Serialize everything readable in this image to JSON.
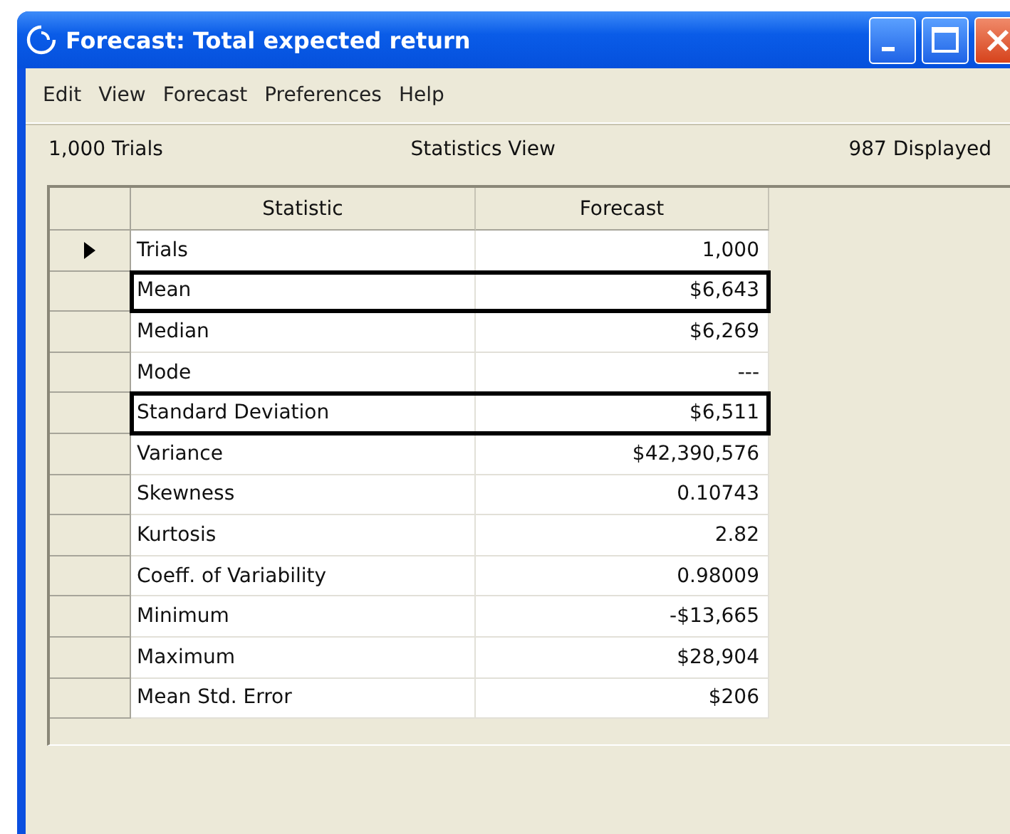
{
  "window": {
    "title": "Forecast: Total expected return"
  },
  "menu": [
    "Edit",
    "View",
    "Forecast",
    "Preferences",
    "Help"
  ],
  "info_bar": {
    "left": "1,000 Trials",
    "center": "Statistics View",
    "right": "987 Displayed"
  },
  "table": {
    "columns": [
      "Statistic",
      "Forecast"
    ],
    "rows": [
      {
        "statistic": "Trials",
        "forecast": "1,000",
        "current": true,
        "outlined": false
      },
      {
        "statistic": "Mean",
        "forecast": "$6,643",
        "current": false,
        "outlined": true
      },
      {
        "statistic": "Median",
        "forecast": "$6,269",
        "current": false,
        "outlined": false
      },
      {
        "statistic": "Mode",
        "forecast": "---",
        "current": false,
        "outlined": false
      },
      {
        "statistic": "Standard Deviation",
        "forecast": "$6,511",
        "current": false,
        "outlined": true
      },
      {
        "statistic": "Variance",
        "forecast": "$42,390,576",
        "current": false,
        "outlined": false
      },
      {
        "statistic": "Skewness",
        "forecast": "0.10743",
        "current": false,
        "outlined": false
      },
      {
        "statistic": "Kurtosis",
        "forecast": "2.82",
        "current": false,
        "outlined": false
      },
      {
        "statistic": "Coeff. of Variability",
        "forecast": "0.98009",
        "current": false,
        "outlined": false
      },
      {
        "statistic": "Minimum",
        "forecast": "-$13,665",
        "current": false,
        "outlined": false
      },
      {
        "statistic": "Maximum",
        "forecast": "$28,904",
        "current": false,
        "outlined": false
      },
      {
        "statistic": "Mean Std. Error",
        "forecast": "$206",
        "current": false,
        "outlined": false
      }
    ]
  }
}
